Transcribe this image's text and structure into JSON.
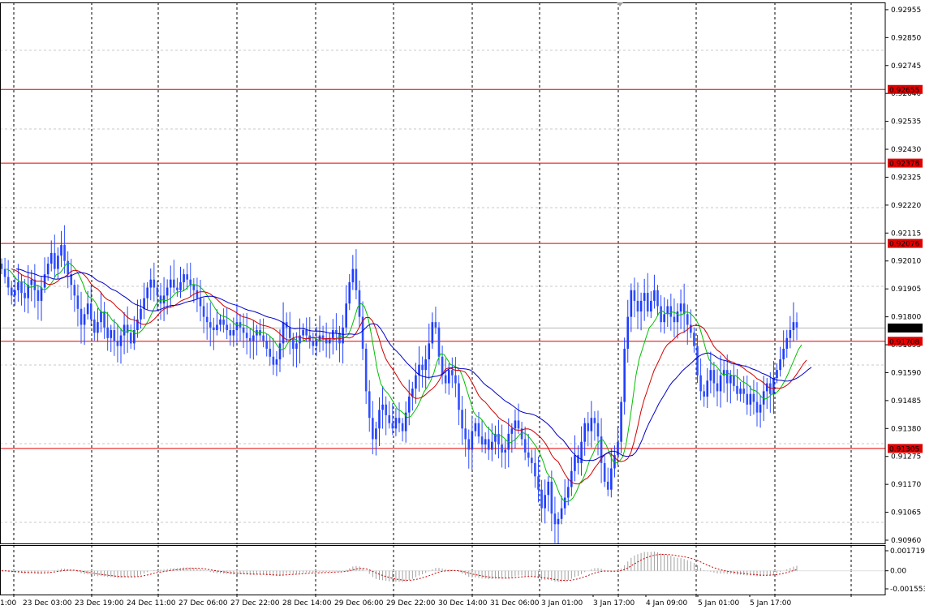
{
  "chart_data": {
    "type": "candlestick",
    "instrument_note": "",
    "price_axis": {
      "ticks": [
        "0.92955",
        "0.92850",
        "0.92745",
        "0.92640",
        "0.92535",
        "0.92430",
        "0.92325",
        "0.92220",
        "0.92115",
        "0.92010",
        "0.91905",
        "0.91800",
        "0.91695",
        "0.91590",
        "0.91485",
        "0.91380",
        "0.91275",
        "0.91170",
        "0.91065",
        "0.90960"
      ],
      "range": [
        0.9096,
        0.9297
      ]
    },
    "time_axis": {
      "labels": [
        "1:00",
        "23 Dec 03:00",
        "23 Dec 19:00",
        "24 Dec 11:00",
        "27 Dec 06:00",
        "27 Dec 22:00",
        "28 Dec 14:00",
        "29 Dec 06:00",
        "29 Dec 22:00",
        "30 Dec 14:00",
        "31 Dec 06:00",
        "3 Jan 01:00",
        "3 Jan 17:00",
        "4 Jan 09:00",
        "5 Jan 01:00",
        "5 Jan 17:00"
      ]
    },
    "current_price": {
      "label": "0.91758",
      "value": 0.91758
    },
    "levels": [
      {
        "label": "0.92655",
        "value": 0.92655,
        "color": "#e00000"
      },
      {
        "label": "0.92378",
        "value": 0.92378,
        "color": "#e00000"
      },
      {
        "label": "0.92076",
        "value": 0.92076,
        "color": "#e00000"
      },
      {
        "label": "0.91708",
        "value": 0.91708,
        "color": "#e00000"
      },
      {
        "label": "0.91305",
        "value": 0.91305,
        "color": "#e00000"
      }
    ],
    "candle_closes": [
      0.9198,
      0.9195,
      0.9191,
      0.9188,
      0.919,
      0.9193,
      0.9189,
      0.9187,
      0.9192,
      0.9194,
      0.919,
      0.9186,
      0.9191,
      0.9196,
      0.92,
      0.9204,
      0.9198,
      0.9203,
      0.9207,
      0.9201,
      0.9196,
      0.9192,
      0.9188,
      0.9183,
      0.9177,
      0.9181,
      0.9185,
      0.9179,
      0.9174,
      0.9178,
      0.9182,
      0.9176,
      0.9172,
      0.9175,
      0.9171,
      0.9169,
      0.9173,
      0.9177,
      0.9174,
      0.917,
      0.9175,
      0.9179,
      0.9183,
      0.9187,
      0.9191,
      0.9194,
      0.9191,
      0.9188,
      0.9185,
      0.9188,
      0.9191,
      0.9194,
      0.9191,
      0.919,
      0.9193,
      0.9196,
      0.9194,
      0.9192,
      0.919,
      0.9187,
      0.9184,
      0.918,
      0.9178,
      0.9176,
      0.9175,
      0.9177,
      0.9179,
      0.9177,
      0.9175,
      0.9173,
      0.9175,
      0.9178,
      0.9176,
      0.9174,
      0.9172,
      0.9171,
      0.9173,
      0.9175,
      0.9173,
      0.9171,
      0.9168,
      0.9165,
      0.9162,
      0.9164,
      0.917,
      0.9178,
      0.9176,
      0.9172,
      0.9168,
      0.917,
      0.9173,
      0.9175,
      0.9173,
      0.9171,
      0.9169,
      0.9171,
      0.9173,
      0.9172,
      0.917,
      0.9172,
      0.9175,
      0.9174,
      0.917,
      0.9176,
      0.9185,
      0.9193,
      0.9198,
      0.919,
      0.918,
      0.9168,
      0.9152,
      0.9142,
      0.9134,
      0.9138,
      0.9145,
      0.9147,
      0.9143,
      0.914,
      0.9138,
      0.9142,
      0.914,
      0.9137,
      0.9144,
      0.915,
      0.9153,
      0.9158,
      0.9162,
      0.916,
      0.9164,
      0.917,
      0.9178,
      0.9176,
      0.9165,
      0.9158,
      0.9155,
      0.916,
      0.9158,
      0.9155,
      0.9145,
      0.9138,
      0.9134,
      0.913,
      0.9137,
      0.914,
      0.9135,
      0.9132,
      0.9134,
      0.913,
      0.9133,
      0.9136,
      0.9132,
      0.9129,
      0.913,
      0.9136,
      0.9138,
      0.9141,
      0.9138,
      0.9134,
      0.9129,
      0.9127,
      0.9125,
      0.912,
      0.9115,
      0.9108,
      0.9113,
      0.9118,
      0.9106,
      0.9102,
      0.9104,
      0.9108,
      0.9112,
      0.9116,
      0.9122,
      0.9128,
      0.9125,
      0.9133,
      0.914,
      0.9137,
      0.9142,
      0.914,
      0.9135,
      0.9125,
      0.9118,
      0.9115,
      0.9123,
      0.9128,
      0.9133,
      0.9148,
      0.9168,
      0.918,
      0.919,
      0.9186,
      0.9182,
      0.9186,
      0.9189,
      0.9182,
      0.9186,
      0.919,
      0.9184,
      0.9178,
      0.9181,
      0.9184,
      0.918,
      0.9178,
      0.9182,
      0.9185,
      0.9181,
      0.9177,
      0.9174,
      0.9169,
      0.9158,
      0.9152,
      0.915,
      0.9156,
      0.916,
      0.9155,
      0.9152,
      0.9158,
      0.916,
      0.9155,
      0.9158,
      0.9154,
      0.9151,
      0.9153,
      0.9151,
      0.9147,
      0.9151,
      0.9148,
      0.9144,
      0.9147,
      0.9152,
      0.9155,
      0.9151,
      0.9157,
      0.916,
      0.9164,
      0.9168,
      0.9172,
      0.9175,
      0.9178,
      0.9176
    ],
    "moving_averages": [
      {
        "color": "#00c000",
        "period_note": ""
      },
      {
        "color": "#d00000",
        "period_note": ""
      },
      {
        "color": "#0000c8",
        "period_note": ""
      }
    ],
    "oscillator": {
      "ticks": [
        "0.001719",
        "0.00",
        "-0.001553"
      ],
      "range": [
        -0.001553,
        0.001719
      ],
      "histogram_color": "#a0a0a0",
      "signal_color": "#d00000"
    }
  }
}
